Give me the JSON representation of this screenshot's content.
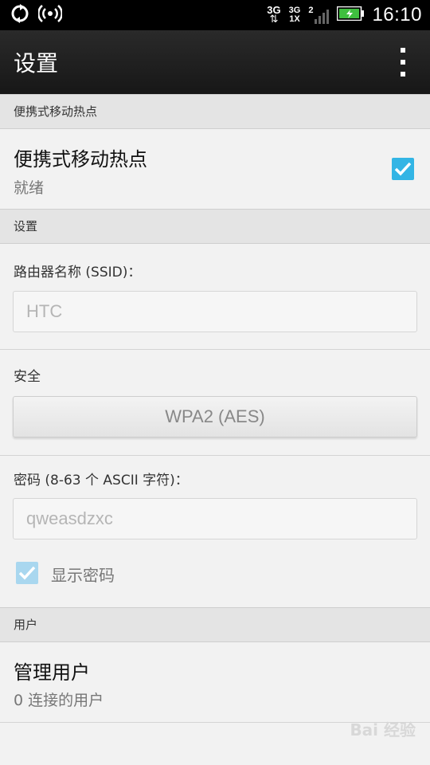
{
  "status_bar": {
    "network_top": "3G",
    "network_mid": "3G",
    "network_mid2": "1X",
    "signal_x": "2",
    "time": "16:10"
  },
  "action_bar": {
    "title": "设置"
  },
  "sections": {
    "hotspot_header": "便携式移动热点",
    "settings_header": "设置",
    "users_header": "用户"
  },
  "hotspot": {
    "title": "便携式移动热点",
    "status": "就绪",
    "enabled": true
  },
  "ssid": {
    "label": "路由器名称 (SSID)：",
    "placeholder": "HTC"
  },
  "security": {
    "label": "安全",
    "value": "WPA2 (AES)"
  },
  "password": {
    "label": "密码 (8-63 个 ASCII 字符)：",
    "placeholder": "qweasdzxc",
    "show_label": "显示密码",
    "show_checked": true
  },
  "users": {
    "title": "管理用户",
    "subtitle": "0 连接的用户"
  },
  "watermark": {
    "text": "Bai 经验"
  },
  "colors": {
    "accent": "#33b5e5",
    "checkbox_light": "#a9d7ef"
  }
}
